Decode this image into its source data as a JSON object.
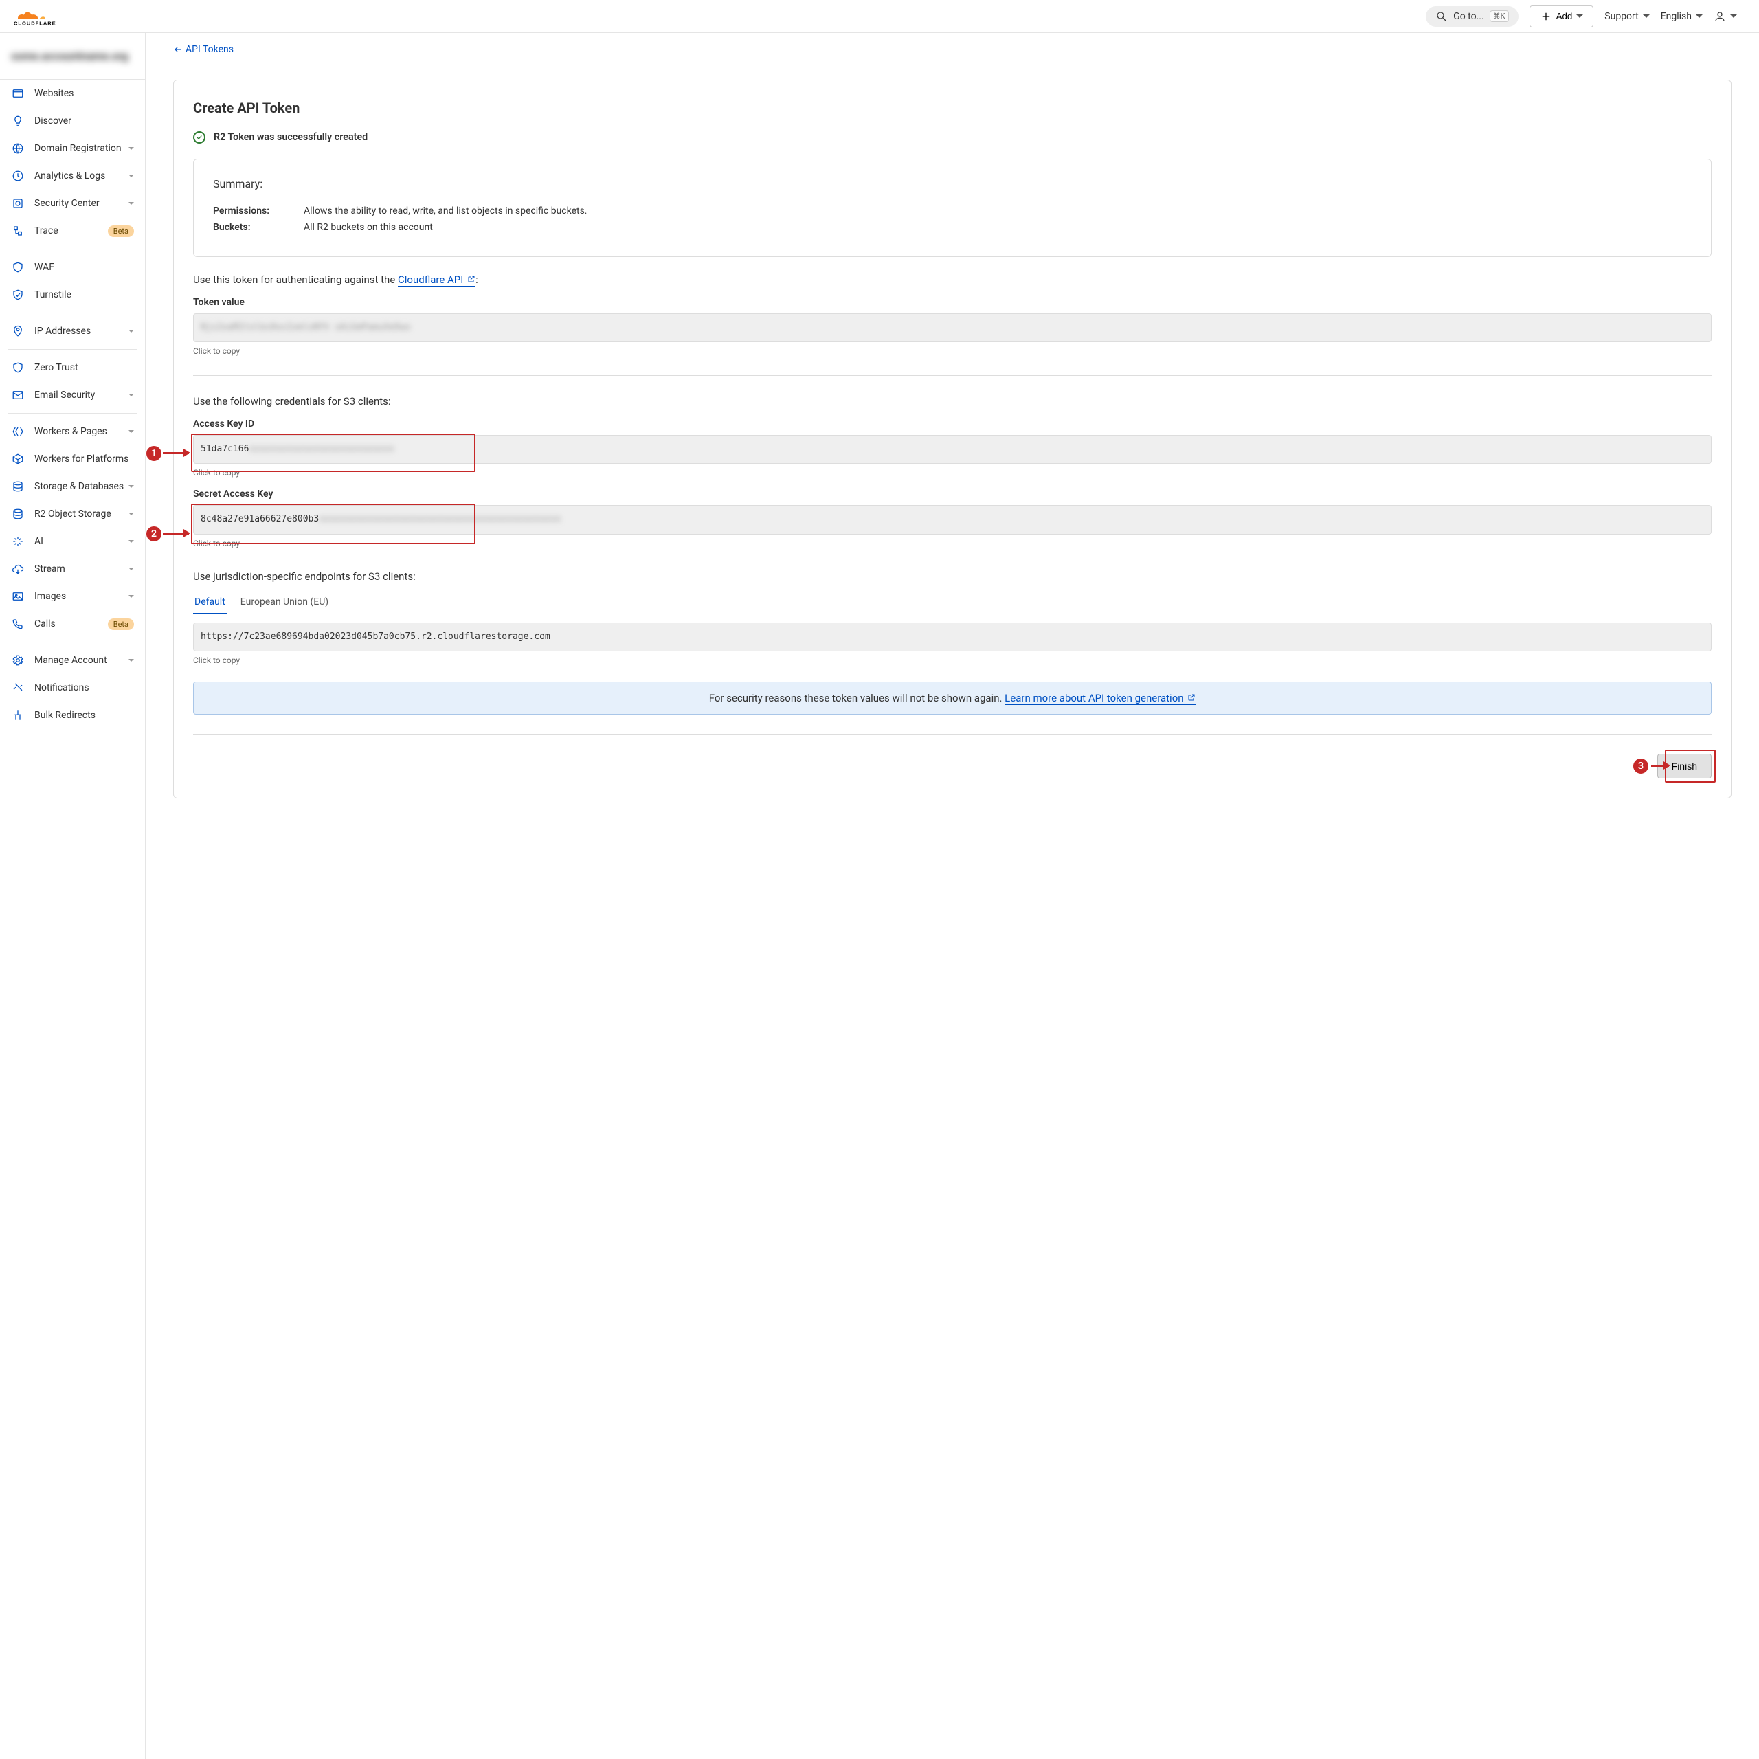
{
  "header": {
    "brand": "CLOUDFLARE",
    "search_placeholder": "Go to...",
    "search_shortcut": "⌘K",
    "add_label": "Add",
    "support": "Support",
    "language": "English"
  },
  "sidebar": {
    "account_name": "some.accountname.org",
    "items": [
      {
        "icon": "window-icon",
        "label": "Websites"
      },
      {
        "icon": "bulb-icon",
        "label": "Discover"
      },
      {
        "icon": "globe-icon",
        "label": "Domain Registration",
        "expandable": true
      },
      {
        "icon": "clock-icon",
        "label": "Analytics & Logs",
        "expandable": true
      },
      {
        "icon": "shield-box-icon",
        "label": "Security Center",
        "expandable": true
      },
      {
        "icon": "trace-icon",
        "label": "Trace",
        "badge": "Beta"
      }
    ],
    "group2": [
      {
        "icon": "shield-icon",
        "label": "WAF"
      },
      {
        "icon": "turnstile-icon",
        "label": "Turnstile"
      }
    ],
    "group3": [
      {
        "icon": "pin-icon",
        "label": "IP Addresses",
        "expandable": true
      }
    ],
    "group4": [
      {
        "icon": "shield-icon",
        "label": "Zero Trust"
      },
      {
        "icon": "mail-icon",
        "label": "Email Security",
        "expandable": true
      }
    ],
    "group5": [
      {
        "icon": "workers-icon",
        "label": "Workers & Pages",
        "expandable": true
      },
      {
        "icon": "box-icon",
        "label": "Workers for Platforms"
      },
      {
        "icon": "db-icon",
        "label": "Storage & Databases",
        "expandable": true
      },
      {
        "icon": "db-icon",
        "label": "R2 Object Storage",
        "expandable": true
      },
      {
        "icon": "sparkle-icon",
        "label": "AI",
        "expandable": true
      },
      {
        "icon": "cloud-icon",
        "label": "Stream",
        "expandable": true
      },
      {
        "icon": "image-icon",
        "label": "Images",
        "expandable": true
      },
      {
        "icon": "phone-icon",
        "label": "Calls",
        "badge": "Beta"
      }
    ],
    "group6": [
      {
        "icon": "gear-icon",
        "label": "Manage Account",
        "expandable": true
      },
      {
        "icon": "bell-icon",
        "label": "Notifications"
      },
      {
        "icon": "redirect-icon",
        "label": "Bulk Redirects"
      }
    ]
  },
  "main": {
    "breadcrumb": "API Tokens",
    "title": "Create API Token",
    "success": "R2 Token was successfully created",
    "summary": {
      "heading": "Summary:",
      "permissions_label": "Permissions:",
      "permissions_value": "Allows the ability to read, write, and list objects in specific buckets.",
      "buckets_label": "Buckets:",
      "buckets_value": "All R2 buckets on this account"
    },
    "auth_text_1": "Use this token for authenticating against the ",
    "auth_link": "Cloudflare API",
    "token_value_label": "Token value",
    "token_value_prefix": "",
    "token_value_blur": "Njx2oaM2tolbs8oxIomloNYh oAiGmPamuXeOwo",
    "click_to_copy": "Click to copy",
    "s3_text": "Use the following credentials for S3 clients:",
    "access_key_label": "Access Key ID",
    "access_key_prefix": "51da7c166",
    "access_key_blur": "xxxxxxxxxxxxxxxxxxxxxxxxxxx",
    "secret_key_label": "Secret Access Key",
    "secret_key_prefix": "8c48a27e91a66627e800b3",
    "secret_key_blur": "xxxxxxxxxxxxxxxxxxxxxxxxxxxxxxxxxxxxxxxxxxxxx",
    "juris_text": "Use jurisdiction-specific endpoints for S3 clients:",
    "tabs": {
      "default": "Default",
      "eu": "European Union (EU)"
    },
    "endpoint": "https://7c23ae689694bda02023d045b7a0cb75.r2.cloudflarestorage.com",
    "banner_text": "For security reasons these token values will not be shown again. ",
    "banner_link": "Learn more about API token generation",
    "finish": "Finish"
  },
  "annotations": {
    "n1": "1",
    "n2": "2",
    "n3": "3"
  }
}
